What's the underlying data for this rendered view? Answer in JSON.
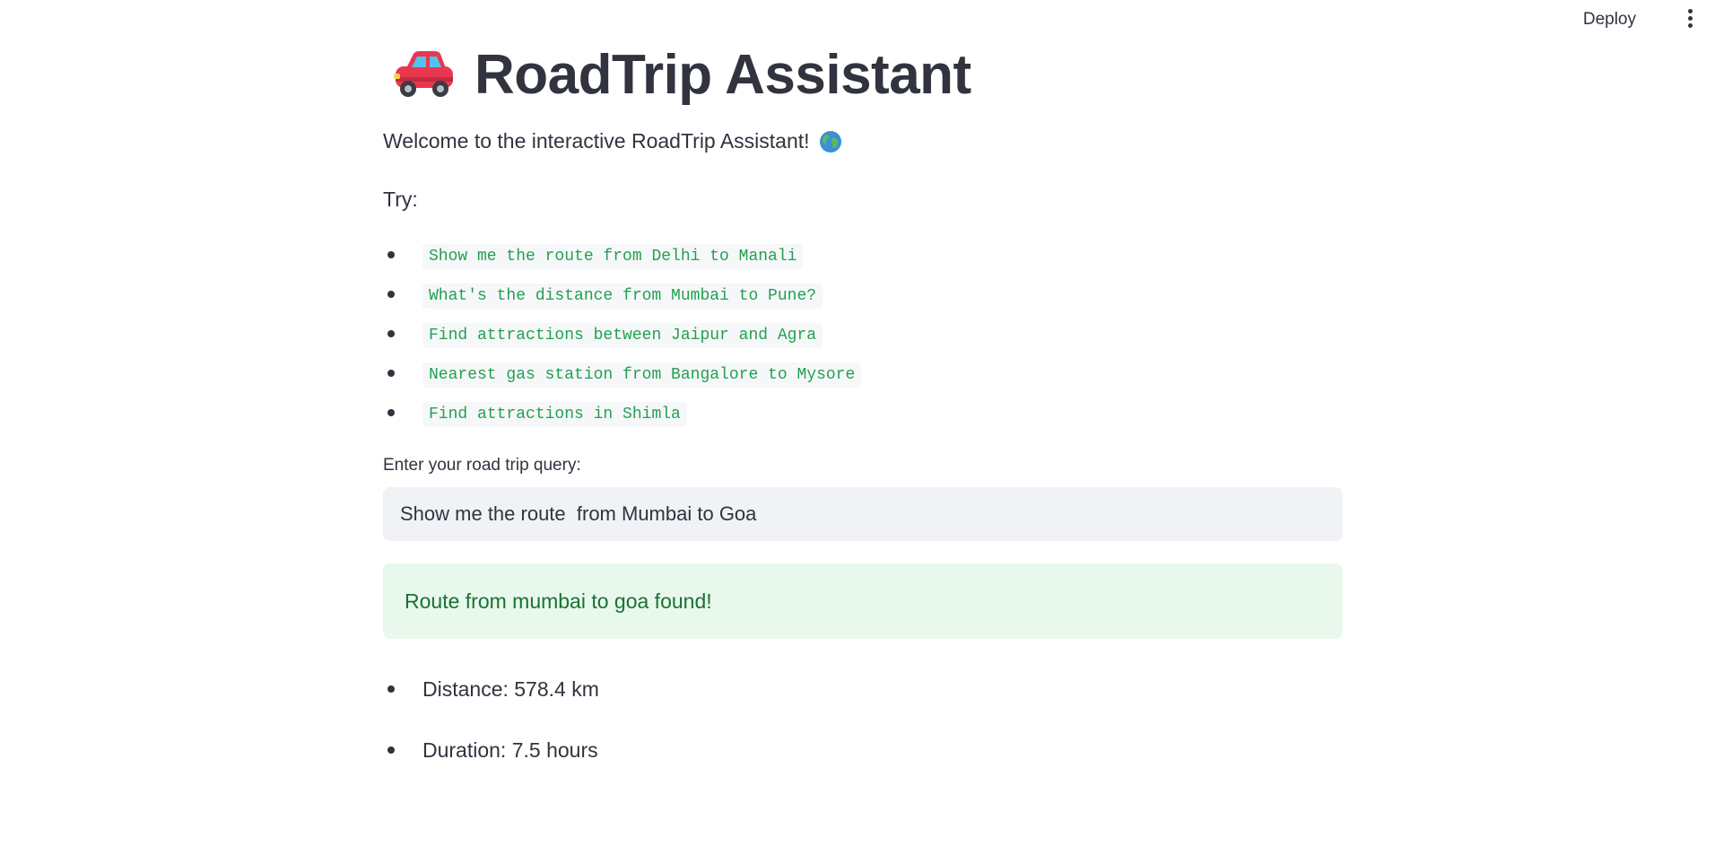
{
  "topbar": {
    "deploy_label": "Deploy",
    "menu_icon": "more-vertical-icon"
  },
  "header": {
    "icon": "car-icon",
    "title": "RoadTrip Assistant"
  },
  "intro": {
    "welcome_text": "Welcome to the interactive RoadTrip Assistant!",
    "welcome_icon": "globe-icon",
    "try_label": "Try:"
  },
  "examples": [
    "Show me the route from Delhi to Manali",
    "What's the distance from Mumbai to Pune?",
    "Find attractions between Jaipur and Agra",
    "Nearest gas station from Bangalore to Mysore",
    "Find attractions in Shimla"
  ],
  "query": {
    "label": "Enter your road trip query:",
    "value": "Show me the route  from Mumbai to Goa"
  },
  "result": {
    "success_message": "Route from mumbai to goa found!",
    "details": [
      "Distance: 578.4 km",
      "Duration: 7.5 hours"
    ]
  },
  "colors": {
    "text": "#31333f",
    "code_green": "#21a150",
    "success_bg": "#e9f8ec",
    "success_text": "#177233",
    "input_bg": "#f0f2f6"
  }
}
